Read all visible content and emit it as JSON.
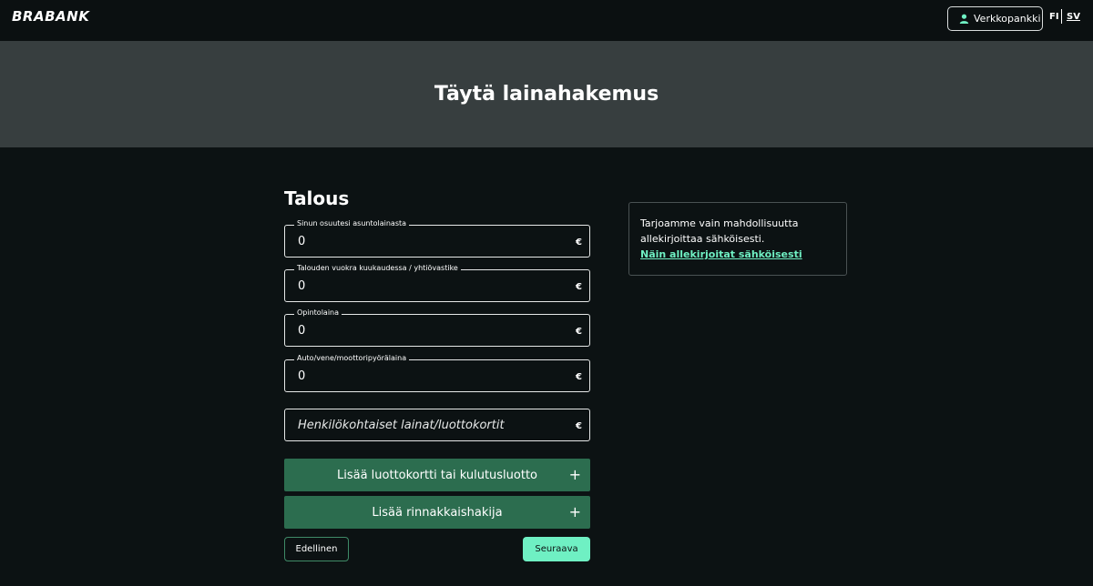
{
  "header": {
    "logo": "BRABANK",
    "netbank_label": "Verkkopankki",
    "lang_fi": "FI",
    "lang_sv": "SV"
  },
  "hero": {
    "title": "Täytä lainahakemus"
  },
  "form": {
    "section_title": "Talous",
    "fields": [
      {
        "label": "Sinun osuutesi asuntolainasta",
        "value": "0",
        "placeholder": "",
        "unit": "€"
      },
      {
        "label": "Talouden vuokra kuukaudessa / yhtiövastike",
        "value": "0",
        "placeholder": "",
        "unit": "€"
      },
      {
        "label": "Opintolaina",
        "value": "0",
        "placeholder": "",
        "unit": "€"
      },
      {
        "label": "Auto/vene/moottoripyörälaina",
        "value": "0",
        "placeholder": "",
        "unit": "€"
      },
      {
        "label": "",
        "value": "",
        "placeholder": "Henkilökohtaiset lainat/luottokortit",
        "unit": "€"
      }
    ],
    "add_credit_label": "Lisää luottokortti tai kulutusluotto",
    "add_coapplicant_label": "Lisää rinnakkaishakija",
    "plus": "+",
    "prev_label": "Edellinen",
    "next_label": "Seuraava"
  },
  "info": {
    "text": "Tarjoamme vain mahdollisuutta allekirjoittaa sähköisesti.",
    "link_label": "Näin allekirjoitat sähköisesti"
  },
  "colors": {
    "background": "#0c1213",
    "hero": "#373e3f",
    "accent": "#6ff0c3",
    "button_green": "#2c6d4f"
  },
  "icons": {
    "netbank": "user-icon"
  }
}
